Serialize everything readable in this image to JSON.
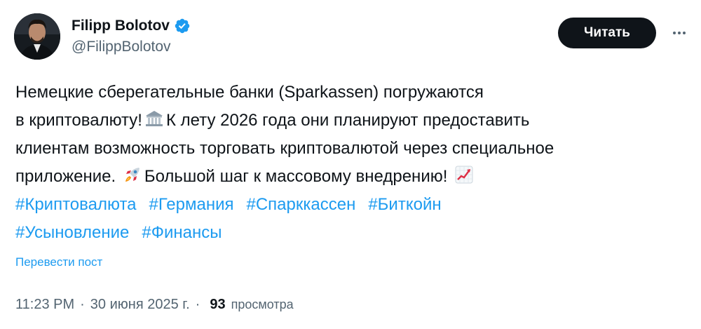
{
  "author": {
    "display_name": "Filipp Bolotov",
    "handle": "@FilippBolotov",
    "verified": true,
    "verified_color": "#1d9bf0"
  },
  "actions": {
    "follow_label": "Читать",
    "more_icon": "more-dots-icon"
  },
  "tweet": {
    "line1": "Немецкие сберегательные банки (Sparkassen) погружаются",
    "line2_a": "в криптовалюту!",
    "line2_b": "К лету 2026 года они планируют предоставить",
    "line3": "клиентам возможность торговать криптовалютой через специальное",
    "line4_a": "приложение.",
    "line4_b": "Большой шаг к массовому внедрению!",
    "emojis": [
      "bank-emoji",
      "rocket-emoji",
      "chart-increasing-emoji"
    ],
    "hashtags_row1": [
      "#Криптовалюта",
      "#Германия",
      "#Спарккассен",
      "#Биткойн"
    ],
    "hashtags_row2": [
      "#Усыновление",
      "#Финансы"
    ],
    "hashtag_color": "#1d9bf0"
  },
  "translate_label": "Перевести пост",
  "meta": {
    "time": "11:23 PM",
    "separator": "·",
    "date": "30 июня 2025 г.",
    "views_count": "93",
    "views_label": "просмотра"
  }
}
